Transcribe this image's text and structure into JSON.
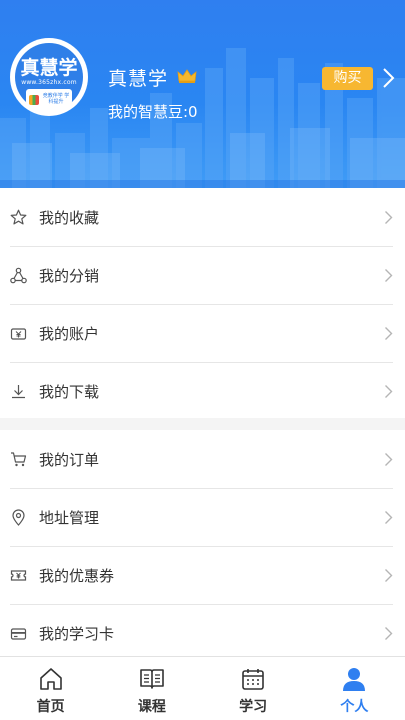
{
  "profile": {
    "logo_text": "真慧学",
    "logo_url": "www.365zhx.com",
    "logo_slogan": "竞教伴学 学科提升",
    "username": "真慧学",
    "beans_label": "我的智慧豆:0",
    "buy_label": "购买",
    "vip_icon": "crown-icon"
  },
  "menu_group_1": [
    {
      "label": "我的收藏",
      "icon": "star-icon"
    },
    {
      "label": "我的分销",
      "icon": "network-icon"
    },
    {
      "label": "我的账户",
      "icon": "wallet-icon"
    },
    {
      "label": "我的下载",
      "icon": "download-icon"
    }
  ],
  "menu_group_2": [
    {
      "label": "我的订单",
      "icon": "cart-icon"
    },
    {
      "label": "地址管理",
      "icon": "location-icon"
    },
    {
      "label": "我的优惠券",
      "icon": "coupon-icon"
    },
    {
      "label": "我的学习卡",
      "icon": "card-icon"
    }
  ],
  "tabs": [
    {
      "label": "首页",
      "icon": "home-icon",
      "active": false
    },
    {
      "label": "课程",
      "icon": "book-icon",
      "active": false
    },
    {
      "label": "学习",
      "icon": "calendar-icon",
      "active": false
    },
    {
      "label": "个人",
      "icon": "person-icon",
      "active": true
    }
  ],
  "colors": {
    "primary": "#2f7ff0",
    "buy_button": "#f7b731",
    "crown": "#f5b82e",
    "text": "#333333",
    "icon_gray": "#555555",
    "chevron": "#b5b5b5"
  }
}
